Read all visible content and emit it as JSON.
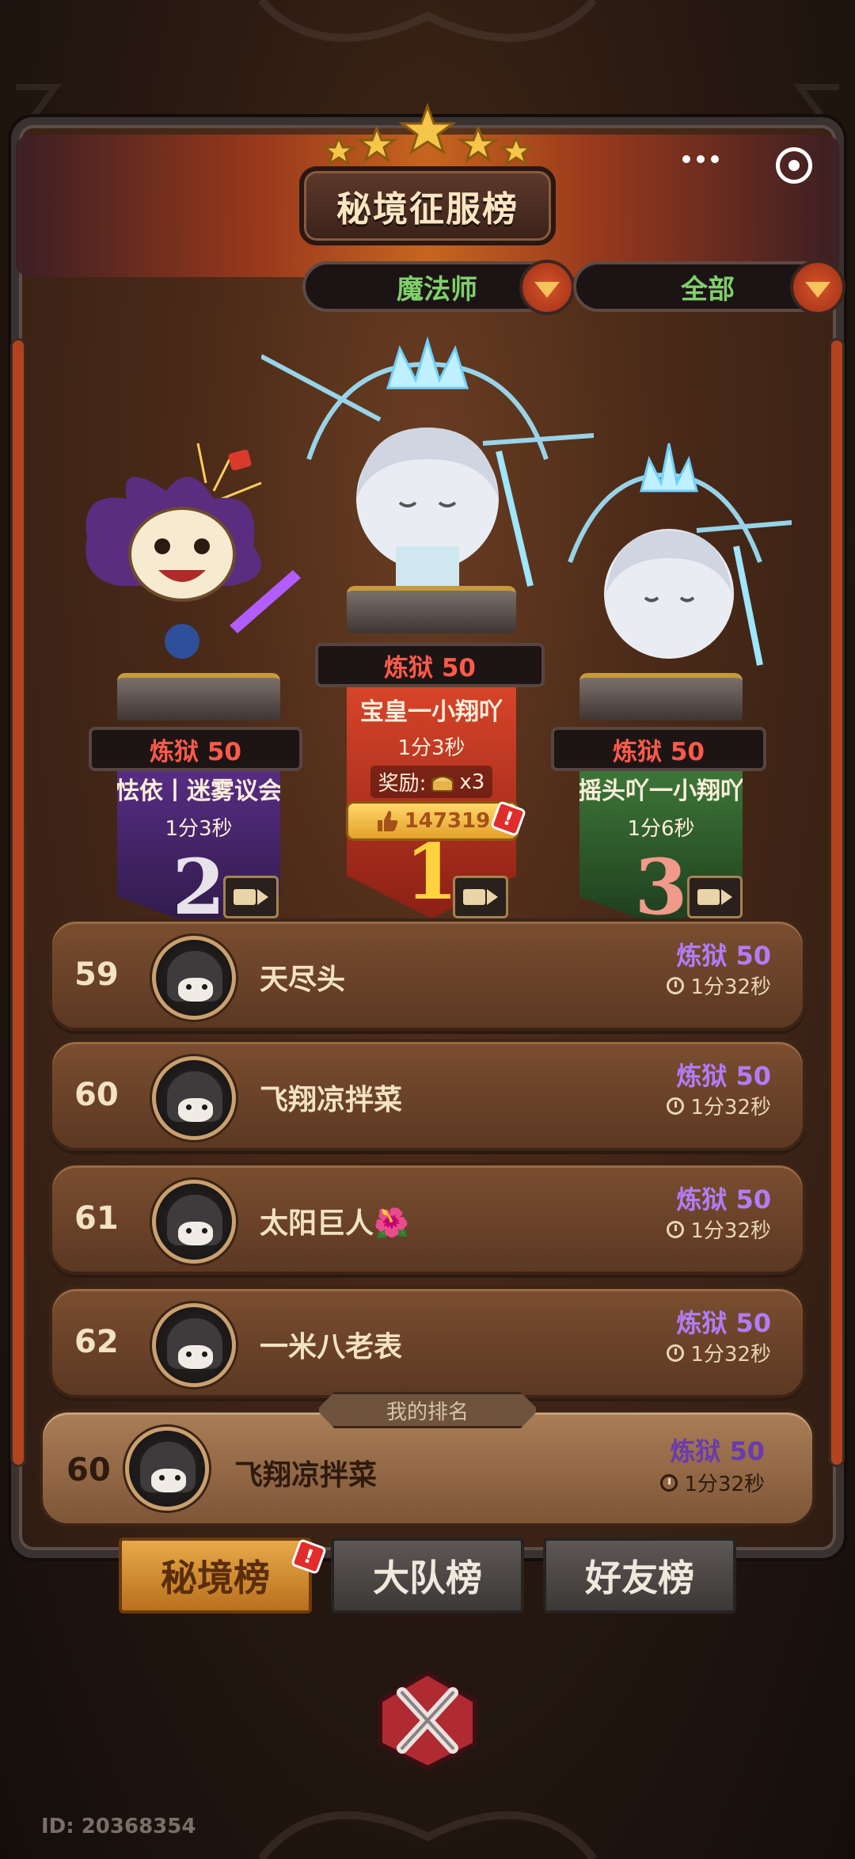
{
  "header": {
    "title": "秘境征服榜",
    "star_count": 5
  },
  "filters": {
    "class_label": "魔法师",
    "scope_label": "全部"
  },
  "podium": {
    "first": {
      "rank": "1",
      "level": "炼狱 50",
      "name": "宝皇一小翔吖",
      "time": "1分3秒",
      "reward_label": "奖励:",
      "reward_count": "x3",
      "likes": "147319",
      "alert": "!"
    },
    "second": {
      "rank": "2",
      "level": "炼狱 50",
      "name": "怯依丨迷雾议会",
      "time": "1分3秒"
    },
    "third": {
      "rank": "3",
      "level": "炼狱 50",
      "name": "摇头吖一小翔吖",
      "time": "1分6秒"
    }
  },
  "ranking_list": [
    {
      "rank": "59",
      "name": "天尽头",
      "level": "炼狱 50",
      "time": "1分32秒"
    },
    {
      "rank": "60",
      "name": "飞翔凉拌菜",
      "level": "炼狱 50",
      "time": "1分32秒"
    },
    {
      "rank": "61",
      "name": "太阳巨人🌺",
      "level": "炼狱 50",
      "time": "1分32秒"
    },
    {
      "rank": "62",
      "name": "一米八老表",
      "level": "炼狱 50",
      "time": "1分32秒"
    }
  ],
  "my_rank": {
    "tag": "我的排名",
    "rank": "60",
    "name": "飞翔凉拌菜",
    "level": "炼狱 50",
    "time": "1分32秒"
  },
  "tabs": {
    "secret": "秘境榜",
    "team": "大队榜",
    "friends": "好友榜",
    "alert": "!"
  },
  "footer": {
    "id": "ID: 20368354"
  },
  "colors": {
    "level_red": "#ff5a4a",
    "level_purple": "#b27cf7",
    "filter_green": "#7fd06a",
    "tab_active": "#e8a94a"
  },
  "icons": [
    "menu-dots-icon",
    "target-icon",
    "caret-down-icon",
    "video-icon",
    "thumbs-up-icon",
    "chest-icon",
    "clock-icon",
    "close-x-icon",
    "star-icon"
  ]
}
